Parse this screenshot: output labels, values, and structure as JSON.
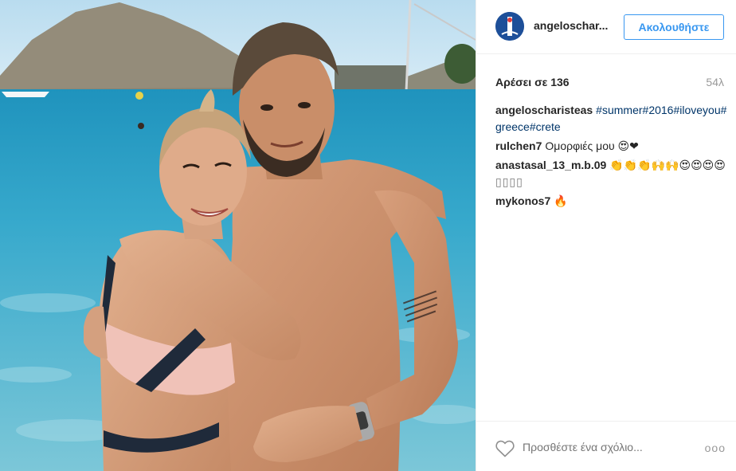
{
  "post": {
    "author": "angeloschar...",
    "follow_label": "Ακολουθήστε",
    "likes_text": "Αρέσει σε 136",
    "time_ago": "54λ",
    "caption": {
      "author": "angeloscharisteas",
      "hashtags": [
        "#summer",
        "#2016",
        "#iloveyou",
        "#greece",
        "#crete"
      ]
    },
    "comments": [
      {
        "author": "rulchen7",
        "text": "Ομορφιές μου 😍❤"
      },
      {
        "author": "anastasal_13_m.b.09",
        "text": "👏👏👏🙌🙌😍😍😍😍",
        "trailing": "▯▯▯▯"
      },
      {
        "author": "mykonos7",
        "text": "🔥"
      }
    ],
    "add_comment_placeholder": "Προσθέστε ένα σχόλιο...",
    "more_label": "ooo"
  },
  "icons": {
    "avatar": "avatar-logo",
    "like": "heart-icon",
    "options": "more-options-icon"
  },
  "colors": {
    "link": "#003569",
    "follow": "#3897f0",
    "muted": "#999999",
    "text": "#262626"
  }
}
